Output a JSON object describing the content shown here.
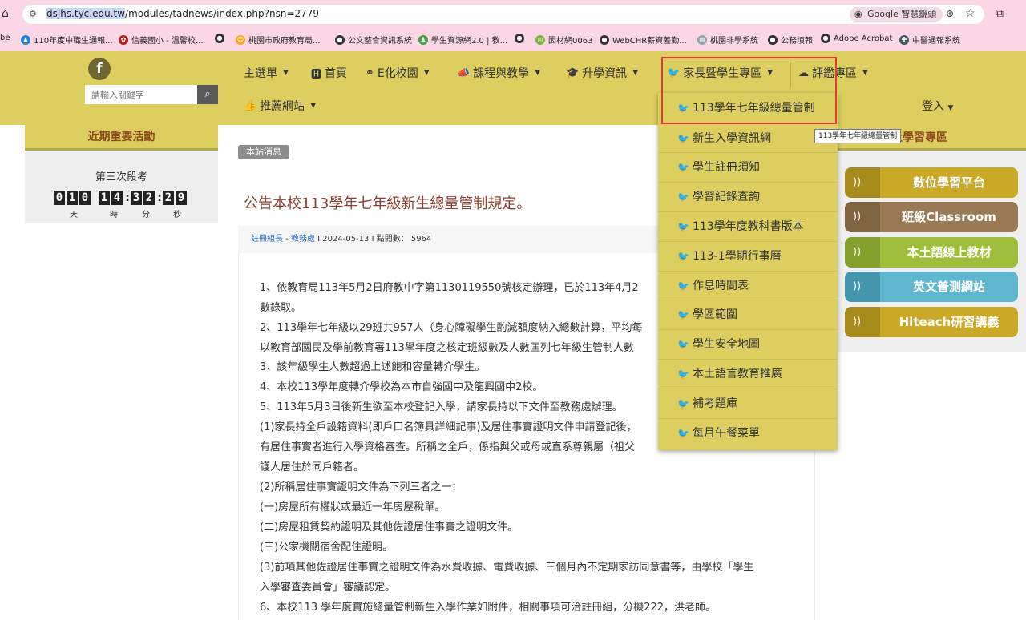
{
  "browser": {
    "url_selected": "dsjhs.tyc.edu.tw",
    "url_rest": "/modules/tadnews/index.php?nsn=2779",
    "lens_label": "Google 智慧鏡頭",
    "bookmarks": [
      "be",
      "110年度中職生通報...",
      "信義國小 - 溫馨校...",
      "桃園市政府教育局...",
      "公文整合資訊系統",
      "學生資源網2.0 | 教...",
      "因材網0063",
      "WebCHR薪資差勤...",
      "桃園非學系統",
      "公務填報",
      "Adobe Acrobat",
      "中醫通報系統"
    ]
  },
  "header": {
    "facebook_glyph": "f",
    "search_placeholder": "請輸入關鍵字",
    "nav": {
      "main_menu": "主選單",
      "home": "首頁",
      "e_campus": "E化校園",
      "curriculum": "課程與教學",
      "further_study": "升學資訊",
      "parents_students": "家長暨學生專區",
      "evaluation": "評鑑專區",
      "recommended": "推薦網站"
    },
    "login": "登入"
  },
  "left_sidebar": {
    "title": "近期重要活動",
    "exam_name": "第三次段考",
    "countdown": {
      "days": [
        "0",
        "1",
        "0"
      ],
      "hours": [
        "1",
        "4"
      ],
      "minutes": [
        "3",
        "2"
      ],
      "seconds": [
        "2",
        "9"
      ]
    },
    "units": {
      "day": "天",
      "hour": "時",
      "minute": "分",
      "second": "秒"
    }
  },
  "article": {
    "badge": "本站消息",
    "title": "公告本校113學年七年級新生總量管制規定。",
    "meta": {
      "author": "註冊組長",
      "sep1": " - ",
      "office": "教務處",
      "date_part": " I 2024-05-13 I 點閱數： 5964"
    },
    "paragraphs": [
      "1、依教育局113年5月2日府教中字第1130119550號核定辦理，已於113年4月2",
      "數錄取。",
      "2、113學年七年級以29班共957人（身心障礙學生酌減額度納入總數計算，平均每",
      "以教育部國民及學前教育署113學年度之核定班級數及人數匡列七年級生管制人數",
      "3、該年級學生人數超過上述飽和容量轉介學生。",
      "4、本校113學年度轉介學校為本市自強國中及龍興國中2校。",
      "5、113年5月3日後新生欲至本校登記入學，請家長持以下文件至教務處辦理。",
      "(1)家長持全戶設籍資料(即戶口名簿具詳細記事)及居住事實證明文件申請登記後，",
      "有居住事實者進行入學資格審查。所稱之全戶，係指與父或母或直系尊親屬（祖父",
      "護人居住於同戶籍者。",
      "(2)所稱居住事實證明文件為下列三者之一：",
      "(一)房屋所有權狀或最近一年房屋稅單。",
      "(二)房屋租賃契約證明及其他佐證居住事實之證明文件。",
      "(三)公家機關宿舍配住證明。",
      "(3)前項其他佐證居住事實之證明文件為水費收據、電費收據、三個月內不定期家訪同意書等，由學校「學生",
      "入學審查委員會」審議認定。",
      "6、本校113 學年度實施總量管制新生入學作業如附件，相關事項可洽註冊組，分機222，洪老師。"
    ]
  },
  "right_sidebar": {
    "title_visible": "上學習專區",
    "buttons": [
      {
        "label": "數位學習平台",
        "color": "#c9a925"
      },
      {
        "label": "班級Classroom",
        "color": "#9a7a54"
      },
      {
        "label": "本土語線上教材",
        "color": "#9fbf3c"
      },
      {
        "label": "英文普測網站",
        "color": "#5fb6cf"
      },
      {
        "label": "Hiteach研習講義",
        "color": "#c9a925"
      }
    ]
  },
  "dropdown": {
    "items": [
      "113學年七年級總量管制",
      "新生入學資訊網",
      "學生註冊須知",
      "學習紀錄查詢",
      "113學年度教科書版本",
      "113-1學期行事曆",
      "作息時間表",
      "學區範圍",
      "學生安全地圖",
      "本土語言教育推廣",
      "補考題庫",
      "每月午餐菜單"
    ]
  },
  "tooltip": "113學年七年級總量管制"
}
